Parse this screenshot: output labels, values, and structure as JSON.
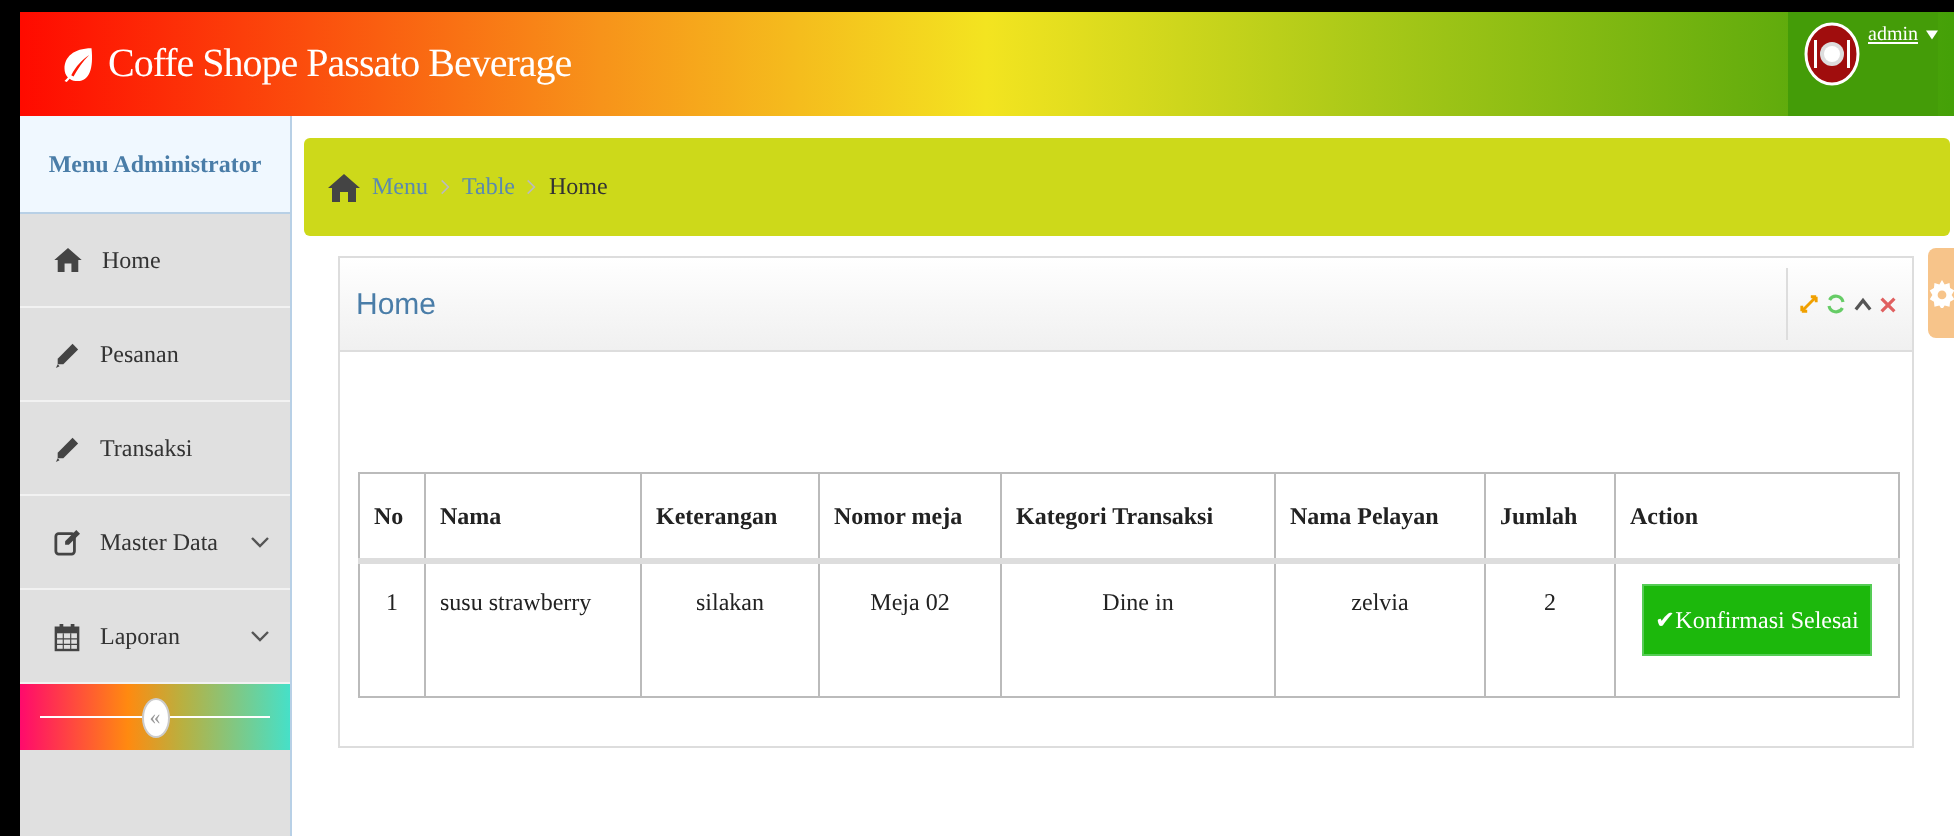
{
  "header": {
    "title": "Coffe Shope Passato Beverage",
    "user": "admin"
  },
  "sidebar": {
    "title": "Menu Administrator",
    "items": [
      {
        "label": "Home",
        "has_submenu": false
      },
      {
        "label": "Pesanan",
        "has_submenu": false
      },
      {
        "label": "Transaksi",
        "has_submenu": false
      },
      {
        "label": "Master Data",
        "has_submenu": true
      },
      {
        "label": "Laporan",
        "has_submenu": true
      }
    ],
    "collapse": "«"
  },
  "breadcrumb": [
    "Menu",
    "Table",
    "Home"
  ],
  "panel": {
    "title": "Home"
  },
  "table": {
    "columns": [
      "No",
      "Nama",
      "Keterangan",
      "Nomor meja",
      "Kategori Transaksi",
      "Nama Pelayan",
      "Jumlah",
      "Action"
    ],
    "rows": [
      {
        "cells": [
          "1",
          "susu strawberry",
          "silakan",
          "Meja 02",
          "Dine in",
          "zelvia",
          "2"
        ],
        "action": "✔Konfirmasi Selesai"
      }
    ]
  }
}
